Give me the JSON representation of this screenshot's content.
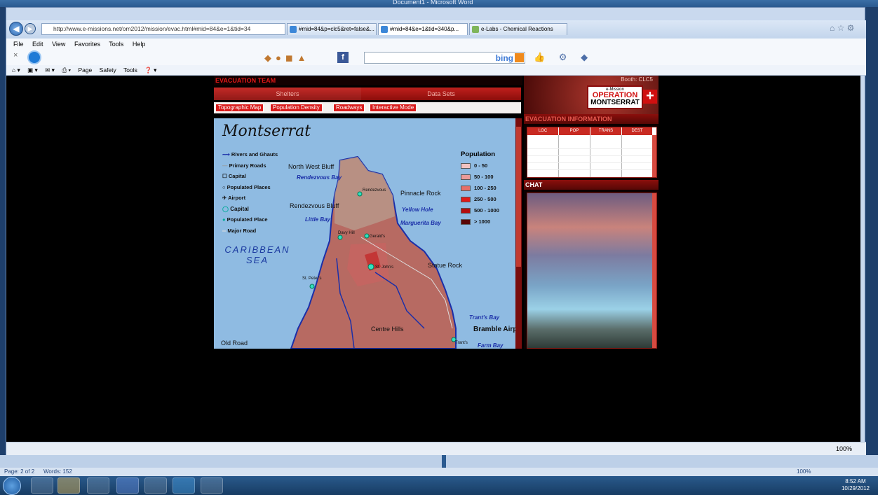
{
  "word": {
    "title": "Document1 - Microsoft Word",
    "status_page": "Page: 2 of 2",
    "status_words": "Words: 152",
    "zoom": "100%"
  },
  "ie": {
    "address": "http://www.e-missions.net/om2012/mission/evac.html#mid=84&e=1&tid=34",
    "tabs": [
      "#mid=84&p=clc5&ret=false&...",
      "#mid=84&e=1&tid=340&p...",
      "e-Labs - Chemical Reactions"
    ],
    "menu": [
      "File",
      "Edit",
      "View",
      "Favorites",
      "Tools",
      "Help"
    ],
    "commands": [
      "Page",
      "Safety",
      "Tools"
    ],
    "search_brand": "bing",
    "status_zoom": "100%"
  },
  "app": {
    "team_title": "EVACUATION TEAM",
    "top_tabs": [
      "Shelters",
      "Data Sets"
    ],
    "sub_tabs": [
      "Topographic Map",
      "Population Density",
      "Roadways",
      "Interactive Mode"
    ],
    "booth": "Booth: CLC5",
    "logo": {
      "small": "e-Mission",
      "line1": "OPERATION",
      "line2": "MONTSERRAT"
    },
    "info_title": "EVACUATION INFORMATION",
    "info_columns": [
      "LOC",
      "POP",
      "TRANS",
      "DEST"
    ],
    "chat_title": "CHAT"
  },
  "map": {
    "title": "Montserrat",
    "legend": [
      "Rivers and Ghauts",
      "Primary Roads",
      "Capital",
      "Populated Places",
      "Airport",
      "Capital",
      "Populated Place",
      "Major Road"
    ],
    "population_title": "Population",
    "population_ranges": [
      {
        "label": "0 - 50",
        "color": "#f2c2c0"
      },
      {
        "label": "50 - 100",
        "color": "#e99a98"
      },
      {
        "label": "100 - 250",
        "color": "#e66f6a"
      },
      {
        "label": "250 - 500",
        "color": "#e01818"
      },
      {
        "label": "500 - 1000",
        "color": "#b40c0c"
      },
      {
        "label": "> 1000",
        "color": "#5a0505"
      }
    ],
    "places": {
      "north_west_bluff": "North West Bluff",
      "pinnacle_rock": "Pinnacle Rock",
      "rendezvous_bluff": "Rendezvous Bluff",
      "statue_rock": "Statue Rock",
      "bramble_airport": "Bramble Airport",
      "centre_hills": "Centre Hills",
      "old_road": "Old Road",
      "rendezvous": "Rendezvous",
      "davy_hill": "Davy Hill",
      "gerald": "Gerald's",
      "st_johns": "St. John's",
      "st_peters": "St. Peter's",
      "trants": "Trant's"
    },
    "bays": {
      "rendezvous_bay": "Rendezvous Bay",
      "yellow_hole": "Yellow Hole",
      "little_bay": "Little Bay",
      "marguerita_bay": "Marguerita Bay",
      "trants_bay": "Trant's Bay",
      "farm_bay": "Farm Bay"
    },
    "sea": "CARIBBEAN SEA"
  },
  "taskbar": {
    "time": "8:52 AM",
    "date": "10/29/2012"
  }
}
